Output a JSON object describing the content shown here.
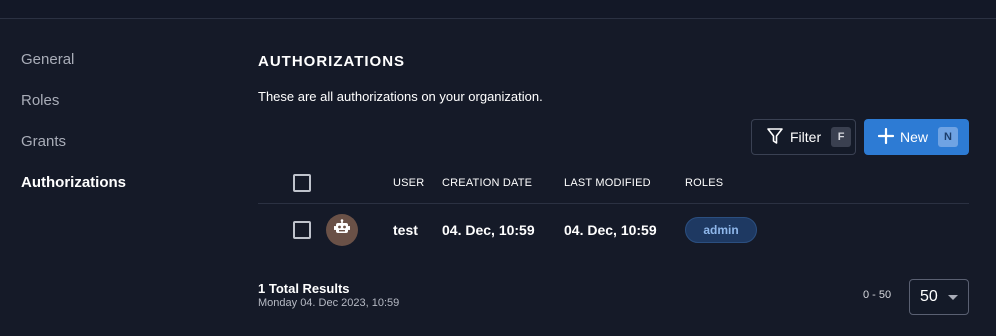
{
  "sidebar": {
    "items": [
      {
        "label": "General",
        "active": false
      },
      {
        "label": "Roles",
        "active": false
      },
      {
        "label": "Grants",
        "active": false
      },
      {
        "label": "Authorizations",
        "active": true
      }
    ]
  },
  "main": {
    "title": "AUTHORIZATIONS",
    "description": "These are all authorizations on your organization."
  },
  "toolbar": {
    "filter_label": "Filter",
    "filter_shortcut": "F",
    "new_label": "New",
    "new_shortcut": "N"
  },
  "table": {
    "columns": [
      "USER",
      "CREATION DATE",
      "LAST MODIFIED",
      "ROLES"
    ],
    "rows": [
      {
        "avatar_icon": "robot-icon",
        "user": "test",
        "creation_date": "04. Dec, 10:59",
        "last_modified": "04. Dec, 10:59",
        "roles": [
          "admin"
        ]
      }
    ]
  },
  "footer": {
    "total": "1 Total Results",
    "timestamp": "Monday 04. Dec 2023, 10:59",
    "range": "0 - 50",
    "page_size": "50"
  },
  "colors": {
    "background": "#151a28",
    "primary": "#2d7bd4",
    "role_badge": "#1e3962"
  }
}
